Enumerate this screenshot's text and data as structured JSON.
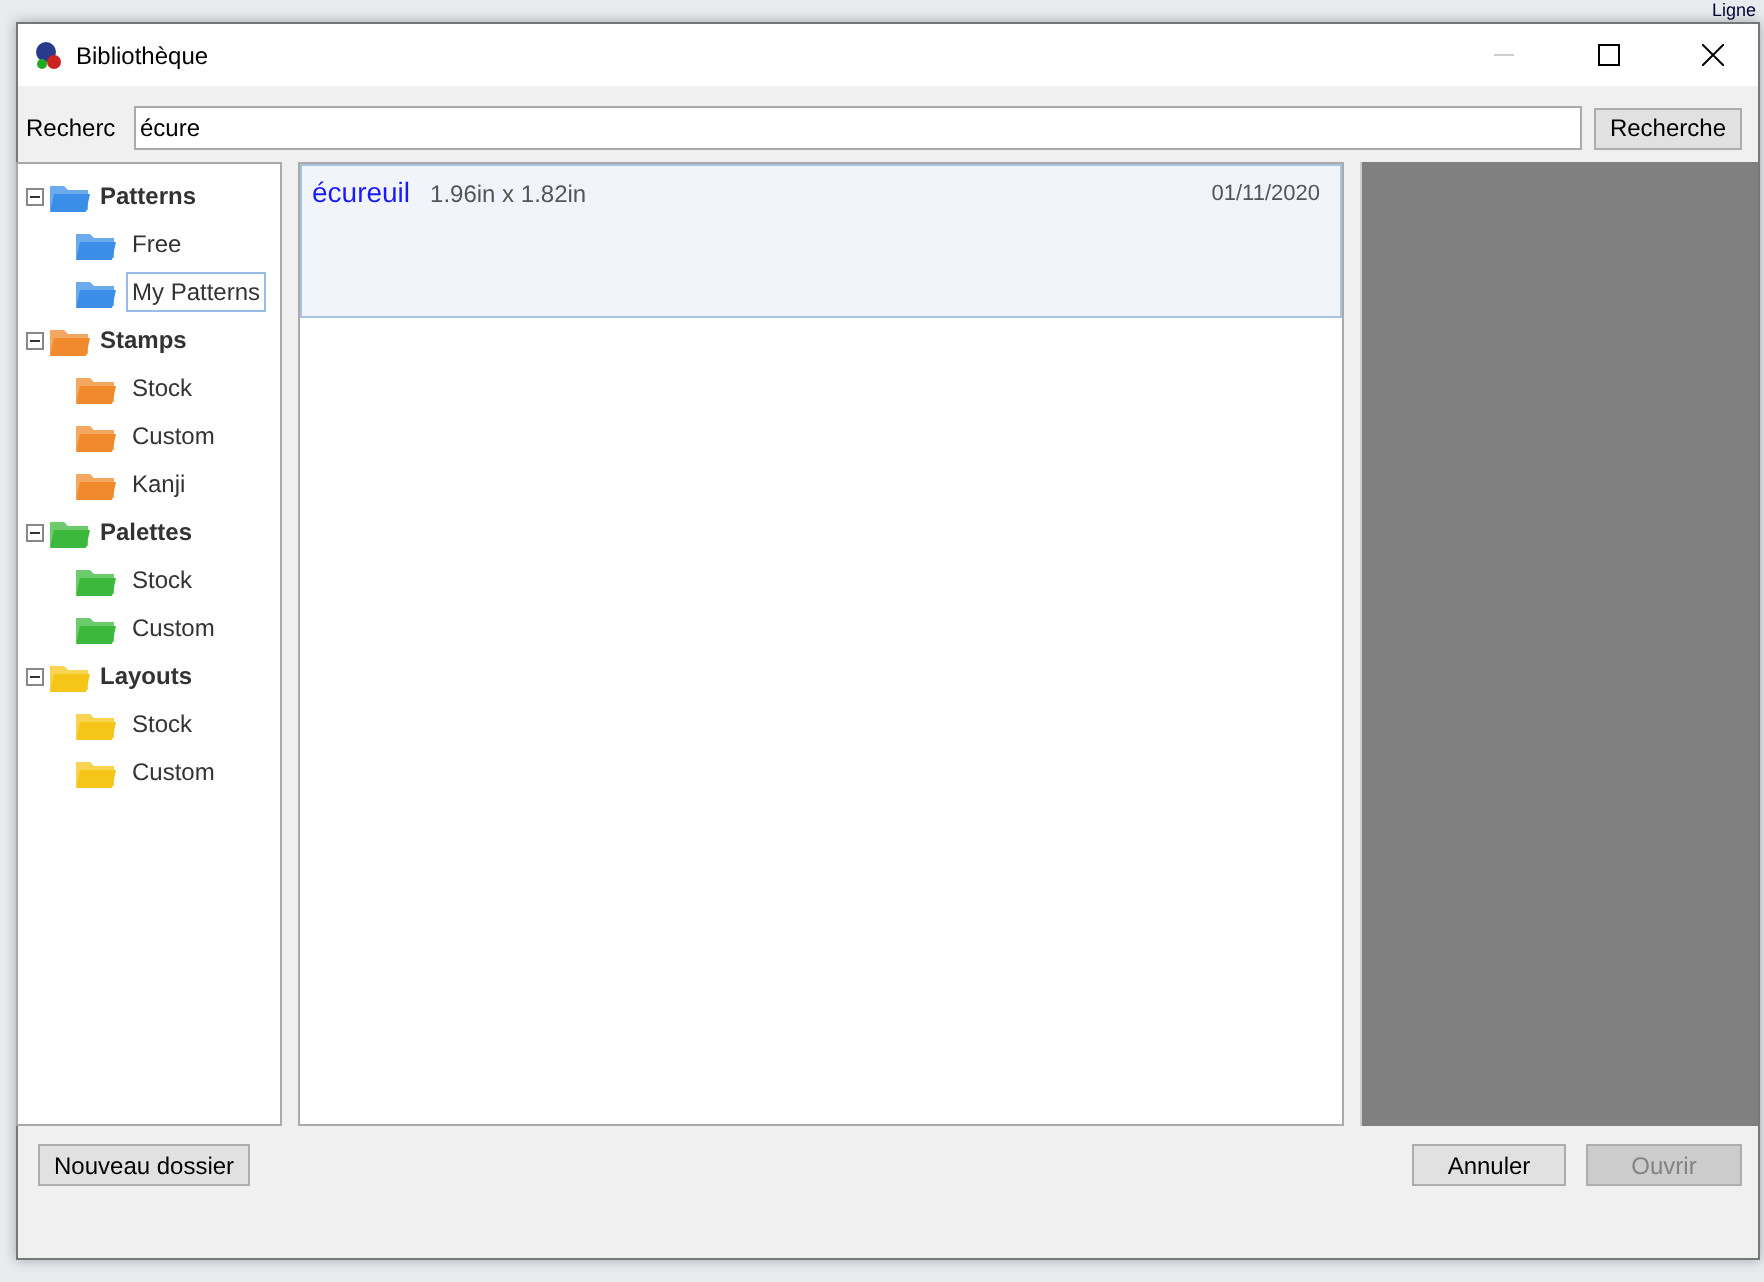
{
  "background_text": "Ligne",
  "window": {
    "title": "Bibliothèque"
  },
  "search": {
    "label": "Recherc",
    "value": "écure",
    "button": "Recherche"
  },
  "tree": [
    {
      "label": "Patterns",
      "color": "#3b8ee8",
      "expanded": true,
      "children": [
        {
          "label": "Free",
          "selected": false
        },
        {
          "label": "My Patterns",
          "selected": true
        }
      ]
    },
    {
      "label": "Stamps",
      "color": "#f08a2c",
      "expanded": true,
      "children": [
        {
          "label": "Stock",
          "selected": false
        },
        {
          "label": "Custom",
          "selected": false
        },
        {
          "label": "Kanji",
          "selected": false
        }
      ]
    },
    {
      "label": "Palettes",
      "color": "#3cb83c",
      "expanded": true,
      "children": [
        {
          "label": "Stock",
          "selected": false
        },
        {
          "label": "Custom",
          "selected": false
        }
      ]
    },
    {
      "label": "Layouts",
      "color": "#f5c518",
      "expanded": true,
      "children": [
        {
          "label": "Stock",
          "selected": false
        },
        {
          "label": "Custom",
          "selected": false
        }
      ]
    }
  ],
  "results": [
    {
      "name": "écureuil",
      "size": "1.96in x 1.82in",
      "date": "01/11/2020",
      "selected": true
    }
  ],
  "buttons": {
    "new_folder": {
      "label": "Nouveau dossier",
      "disabled": false
    },
    "cancel": {
      "label": "Annuler",
      "disabled": false
    },
    "open": {
      "label": "Ouvrir",
      "disabled": true
    }
  }
}
